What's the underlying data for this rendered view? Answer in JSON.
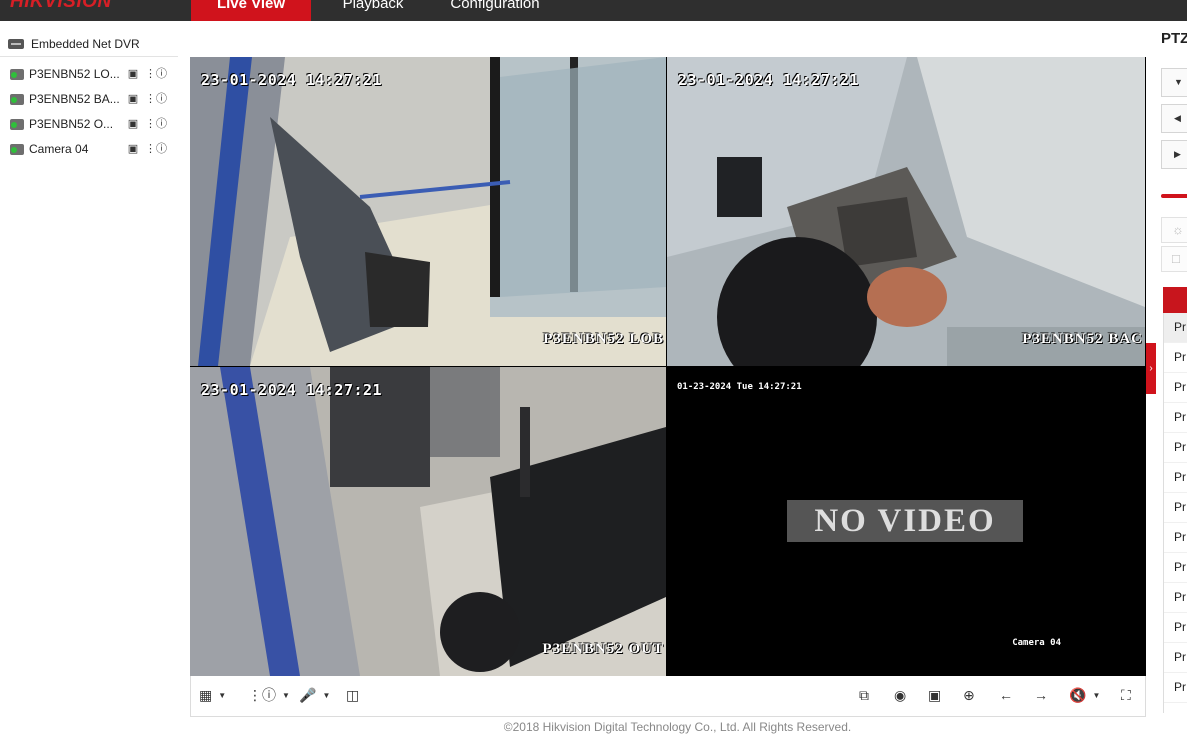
{
  "brand": {
    "logo": "HIKVISION",
    "accent": "#d0131c"
  },
  "nav": {
    "live_view": "Live View",
    "playback": "Playback",
    "configuration": "Configuration"
  },
  "sidebar": {
    "device": "Embedded Net DVR",
    "cameras": [
      {
        "label": "P3ENBN52 LO..."
      },
      {
        "label": "P3ENBN52 BA..."
      },
      {
        "label": "P3ENBN52 O..."
      },
      {
        "label": "Camera 04"
      }
    ]
  },
  "tiles": [
    {
      "timestamp": "23-01-2024 14:27:21",
      "name": "P3ENBN52 LOB",
      "selected": true
    },
    {
      "timestamp": "23-01-2024 14:27:21",
      "name": "P3ENBN52 BAC",
      "selected": false
    },
    {
      "timestamp": "23-01-2024 14:27:21",
      "name": "P3ENBN52 OUT",
      "selected": false
    },
    {
      "timestamp": "01-23-2024 Tue 14:27:21",
      "no_video": "NO VIDEO",
      "name": "Camera 04"
    }
  ],
  "ptz": {
    "title": "PTZ",
    "buttons": [
      "down-arrow-icon",
      "left-arrow-icon",
      "right-arrow-icon"
    ],
    "tools": [
      "light-icon",
      "focus-icon"
    ],
    "presets": [
      "Pr",
      "Pr",
      "Pr",
      "Pr",
      "Pr",
      "Pr",
      "Pr",
      "Pr",
      "Pr",
      "Pr",
      "Pr",
      "Pr",
      "Pr"
    ]
  },
  "toolbar": {
    "left": [
      "layout-icon",
      "stream-icon",
      "microphone-icon",
      "wiper-icon"
    ],
    "right": [
      "stop-all-icon",
      "capture-icon",
      "record-icon",
      "digital-zoom-icon",
      "previous-page-icon",
      "next-page-icon",
      "volume-muted-icon",
      "fullscreen-icon"
    ]
  },
  "footer": {
    "copyright": "©2018 Hikvision Digital Technology Co., Ltd. All Rights Reserved."
  }
}
